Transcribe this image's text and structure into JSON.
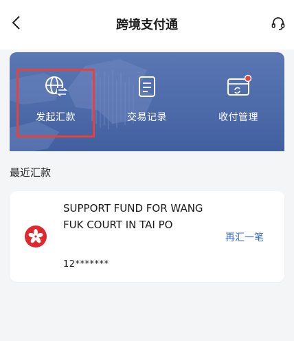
{
  "header": {
    "title": "跨境支付通",
    "back_icon": "chevron-left-icon",
    "support_icon": "headset-icon"
  },
  "banner": {
    "colors": {
      "top": "#5a77b4",
      "bottom": "#3f5c9c",
      "highlight": "#e8403a",
      "badge": "#e8403a"
    },
    "actions": [
      {
        "label": "发起汇款",
        "icon": "globe-transfer-icon",
        "highlighted": true
      },
      {
        "label": "交易记录",
        "icon": "document-list-icon",
        "highlighted": false
      },
      {
        "label": "收付管理",
        "icon": "card-sync-icon",
        "highlighted": false,
        "badge": true
      }
    ]
  },
  "recent": {
    "title": "最近汇款",
    "items": [
      {
        "name": "SUPPORT FUND FOR WANG FUK COURT IN TAI PO",
        "account": "12*******",
        "flag_icon": "hong-kong-flag-icon",
        "action_label": "再汇一笔",
        "action_color": "#3a6cd8"
      }
    ]
  }
}
